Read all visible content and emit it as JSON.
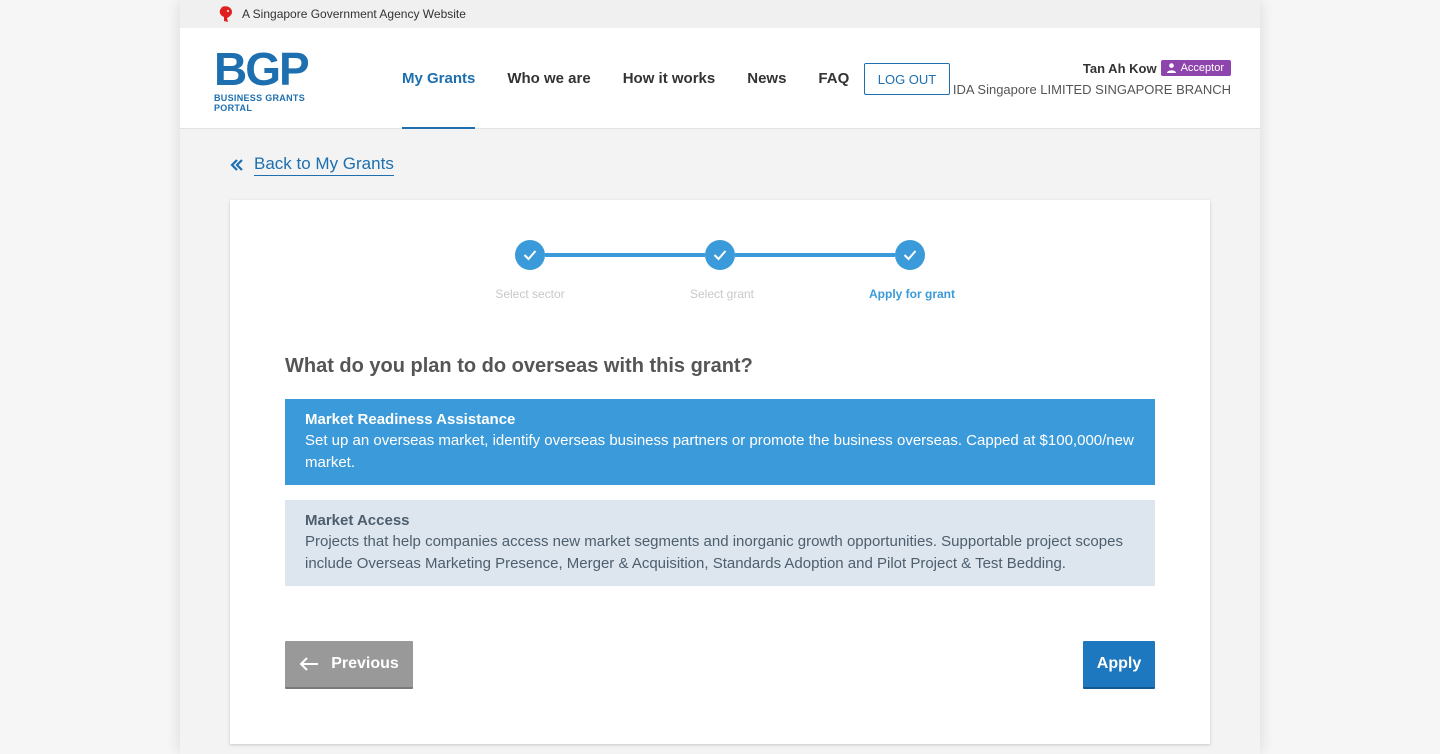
{
  "gov_banner": {
    "text": "A Singapore Government Agency Website",
    "icon": "lion-head-icon"
  },
  "logo": {
    "mark": "BGP",
    "subtitle": "BUSINESS GRANTS PORTAL"
  },
  "nav": {
    "items": [
      {
        "label": "My Grants",
        "active": true
      },
      {
        "label": "Who we are",
        "active": false
      },
      {
        "label": "How it works",
        "active": false
      },
      {
        "label": "News",
        "active": false
      },
      {
        "label": "FAQ",
        "active": false
      }
    ],
    "logout_label": "LOG OUT"
  },
  "user": {
    "name": "Tan Ah Kow",
    "role": "Acceptor",
    "org": "IDA Singapore LIMITED SINGAPORE BRANCH"
  },
  "back_link": {
    "label": "Back to My Grants",
    "icon": "double-chevron-left-icon"
  },
  "stepper": {
    "steps": [
      {
        "label": "Select sector",
        "done": true
      },
      {
        "label": "Select grant",
        "done": true
      },
      {
        "label": "Apply for grant",
        "done": true,
        "current": true
      }
    ]
  },
  "question": "What do you plan to do overseas with this grant?",
  "options": [
    {
      "title": "Market Readiness Assistance",
      "description": "Set up an overseas market, identify overseas business partners or promote the business overseas. Capped at $100,000/new market.",
      "selected": true
    },
    {
      "title": "Market Access",
      "description": "Projects that help companies access new market segments and inorganic growth opportunities. Supportable project scopes include Overseas Marketing Presence, Merger & Acquisition, Standards Adoption and Pilot Project & Test Bedding.",
      "selected": false
    }
  ],
  "buttons": {
    "previous": "Previous",
    "apply": "Apply"
  },
  "colors": {
    "brand": "#1d6fb0",
    "accent": "#3b9ad9",
    "role_badge": "#8e44ad",
    "option_unselected": "#dde6ee",
    "button_disabled": "#999999"
  }
}
